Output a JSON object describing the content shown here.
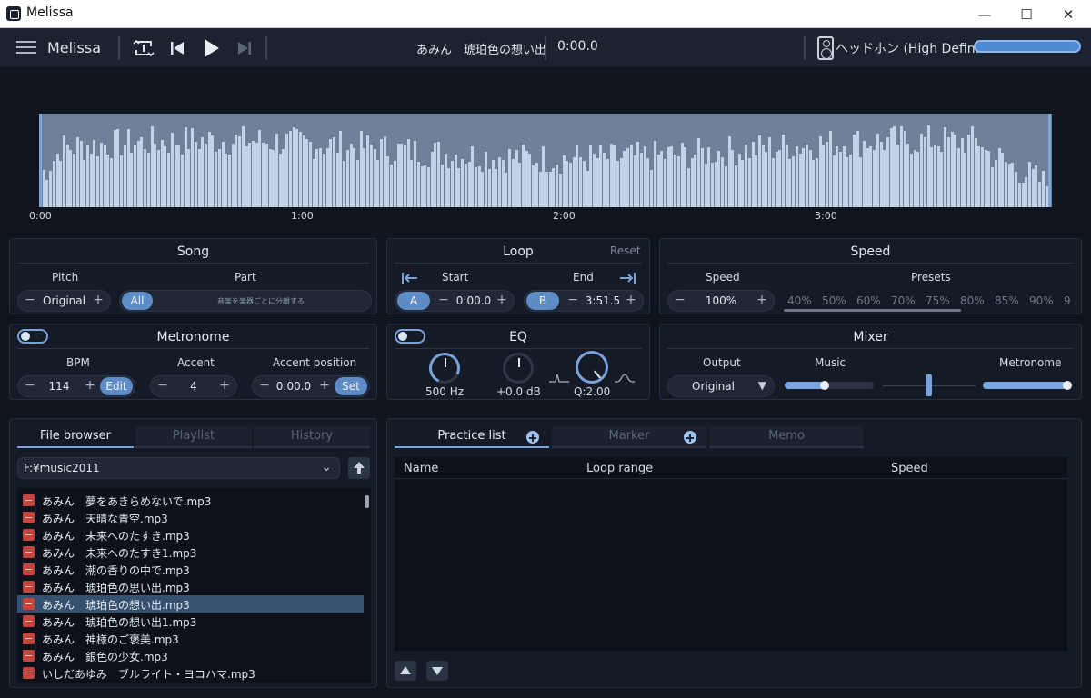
{
  "window": {
    "title": "Melissa",
    "minimize": "—",
    "maximize": "☐",
    "close": "✕"
  },
  "toolbar": {
    "app_name": "Melissa",
    "now_playing": "あみん　琥珀色の想い出",
    "time": "0:00.0",
    "device": "ヘッドホン (High Definit..."
  },
  "timeline": {
    "ticks": [
      "0:00",
      "1:00",
      "2:00",
      "3:00"
    ]
  },
  "song": {
    "title": "Song",
    "pitch_label": "Pitch",
    "pitch_value": "Original",
    "part_label": "Part",
    "part_all": "All",
    "part_hint": "音楽を楽器ごとに分離する"
  },
  "loop": {
    "title": "Loop",
    "reset": "Reset",
    "start_label": "Start",
    "end_label": "End",
    "a_label": "A",
    "start_value": "0:00.0",
    "b_label": "B",
    "end_value": "3:51.5"
  },
  "speed": {
    "title": "Speed",
    "speed_label": "Speed",
    "speed_value": "100%",
    "presets_label": "Presets",
    "presets": [
      "40%",
      "50%",
      "60%",
      "70%",
      "75%",
      "80%",
      "85%",
      "90%",
      "9"
    ]
  },
  "metronome": {
    "title": "Metronome",
    "enabled": false,
    "bpm_label": "BPM",
    "bpm_value": "114",
    "edit": "Edit",
    "accent_label": "Accent",
    "accent_value": "4",
    "accent_pos_label": "Accent position",
    "accent_pos_value": "0:00.0",
    "set": "Set"
  },
  "eq": {
    "title": "EQ",
    "enabled": false,
    "freq": "500 Hz",
    "gain": "+0.0 dB",
    "q": "Q:2.00"
  },
  "mixer": {
    "title": "Mixer",
    "output_label": "Output",
    "output_value": "Original",
    "music_label": "Music",
    "metronome_label": "Metronome",
    "music_level": 0.45,
    "metronome_level": 0.95
  },
  "browser": {
    "tabs": [
      "File browser",
      "Playlist",
      "History"
    ],
    "path": "F:¥music2011",
    "files": [
      "あみん　夢をあきらめないで.mp3",
      "あみん　天晴な青空.mp3",
      "あみん　未来へのたすき.mp3",
      "あみん　未来へのたすき1.mp3",
      "あみん　潮の香りの中で.mp3",
      "あみん　琥珀色の思い出.mp3",
      "あみん　琥珀色の想い出.mp3",
      "あみん　琥珀色の想い出1.mp3",
      "あみん　神様のご褒美.mp3",
      "あみん　銀色の少女.mp3",
      "いしだあゆみ　ブルライト・ヨコハマ.mp3"
    ],
    "selected_index": 6
  },
  "practice": {
    "tabs": [
      "Practice list",
      "Marker",
      "Memo"
    ],
    "columns": [
      "Name",
      "Loop range",
      "Speed"
    ]
  }
}
